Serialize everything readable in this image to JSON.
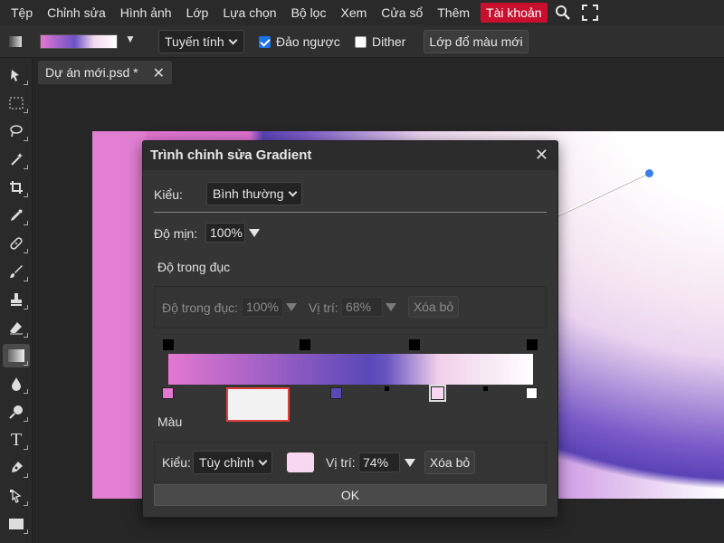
{
  "menu": {
    "items": [
      "Tệp",
      "Chỉnh sửa",
      "Hình ảnh",
      "Lớp",
      "Lựa chọn",
      "Bộ lọc",
      "Xem",
      "Cửa sổ",
      "Thêm"
    ],
    "account_label": "Tài khoản",
    "account_color": "#c8102e",
    "icons": [
      "search-icon",
      "fullscreen-icon"
    ]
  },
  "options": {
    "gradient_stops_preview": [
      "#e477d1",
      "#6b53c6",
      "#f3d8ee",
      "#ffffff"
    ],
    "type_label": "Tuyến tính",
    "reverse_label": "Đảo ngược",
    "reverse_checked": true,
    "dither_label": "Dither",
    "dither_checked": false,
    "new_gradient_layer_label": "Lớp đổ màu mới"
  },
  "toolbar": {
    "tools": [
      "move-tool",
      "marquee-tool",
      "lasso-tool",
      "magic-wand-tool",
      "crop-tool",
      "eyedropper-tool",
      "healing-tool",
      "brush-tool",
      "stamp-tool",
      "eraser-tool",
      "gradient-tool",
      "blur-tool",
      "dodge-tool",
      "type-tool",
      "pen-tool",
      "path-select-tool",
      "shape-tool"
    ],
    "active": "gradient-tool"
  },
  "tab": {
    "title": "Dự án mới.psd *",
    "close": "✕"
  },
  "dialog": {
    "title": "Trình chỉnh sửa Gradient",
    "close": "✕",
    "type_label": "Kiểu:",
    "type_value": "Bình thường",
    "smoothness_label": "Độ mịn:",
    "smoothness_value": "100%",
    "opacity_section_label": "Độ trong đục",
    "opacity_stop": {
      "opacity_label": "Độ trong đục:",
      "opacity_value": "100%",
      "position_label": "Vị trí:",
      "position_value": "68%",
      "delete_label": "Xóa bỏ"
    },
    "color_section_label": "Màu",
    "color_stop": {
      "type_label": "Kiểu:",
      "type_value": "Tùy chỉnh",
      "swatch_color": "#f8d8f0",
      "position_label": "Vị trí:",
      "position_value": "74%",
      "delete_label": "Xóa bỏ"
    },
    "ok_label": "OK",
    "color_stops": [
      {
        "color": "#e477d1",
        "position": 0
      },
      {
        "color": "#5a48b8",
        "position": 45
      },
      {
        "color": "#f8d8f0",
        "position": 74,
        "selected": true
      },
      {
        "color": "#ffffff",
        "position": 100
      }
    ]
  },
  "colors": {
    "accent": "#1a73e8",
    "handle": "#3a7ee8"
  }
}
